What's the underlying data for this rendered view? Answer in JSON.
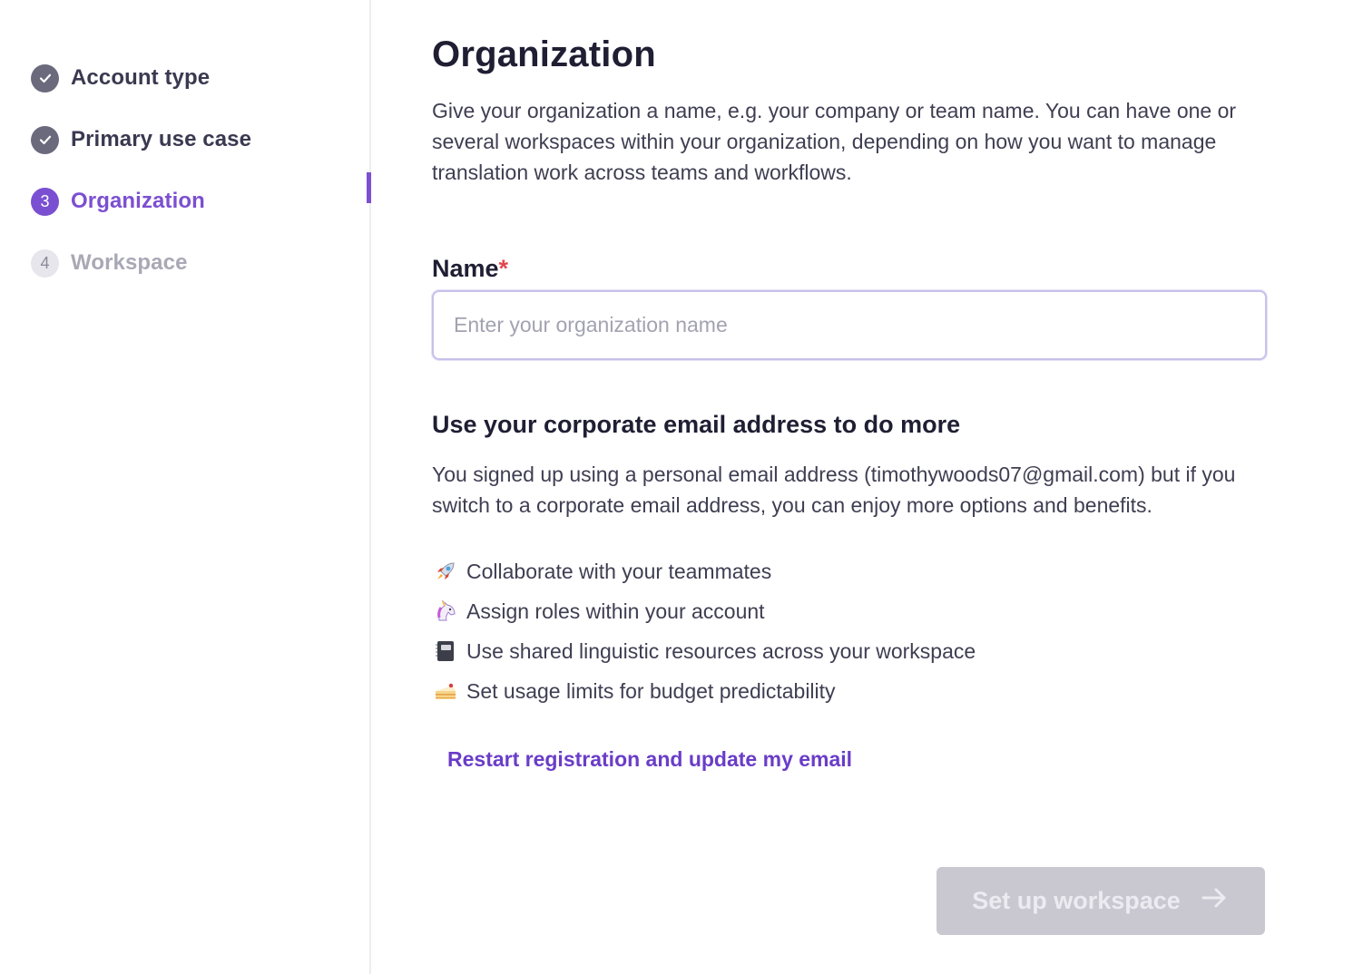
{
  "sidebar": {
    "steps": [
      {
        "label": "Account type",
        "state": "done",
        "icon": "check-icon"
      },
      {
        "label": "Primary use case",
        "state": "done",
        "icon": "check-icon"
      },
      {
        "label": "Organization",
        "state": "active",
        "number": "3"
      },
      {
        "label": "Workspace",
        "state": "todo",
        "number": "4"
      }
    ]
  },
  "main": {
    "title": "Organization",
    "intro": "Give your organization a name, e.g. your company or team name. You can have one or several workspaces within your organization, depending on how you want to manage translation work across teams and workflows.",
    "name_field": {
      "label": "Name",
      "required_mark": "*",
      "placeholder": "Enter your organization name",
      "value": ""
    },
    "corporate": {
      "title": "Use your corporate email address to do more",
      "body": "You signed up using a personal email address (timothywoods07@gmail.com) but if you switch to a corporate email address, you can enjoy more options and benefits.",
      "benefits": [
        {
          "icon": "rocket-icon",
          "text": "Collaborate with your teammates"
        },
        {
          "icon": "unicorn-icon",
          "text": "Assign roles within your account"
        },
        {
          "icon": "notebook-icon",
          "text": "Use shared linguistic resources across your workspace"
        },
        {
          "icon": "cake-icon",
          "text": "Set usage limits for budget predictability"
        }
      ],
      "restart_link": "Restart registration and update my email"
    },
    "cta_label": "Set up workspace"
  },
  "colors": {
    "accent": "#7b4fd1",
    "link": "#6a3dc8",
    "required": "#e0484e",
    "cta_disabled_bg": "#c9c8d1"
  }
}
